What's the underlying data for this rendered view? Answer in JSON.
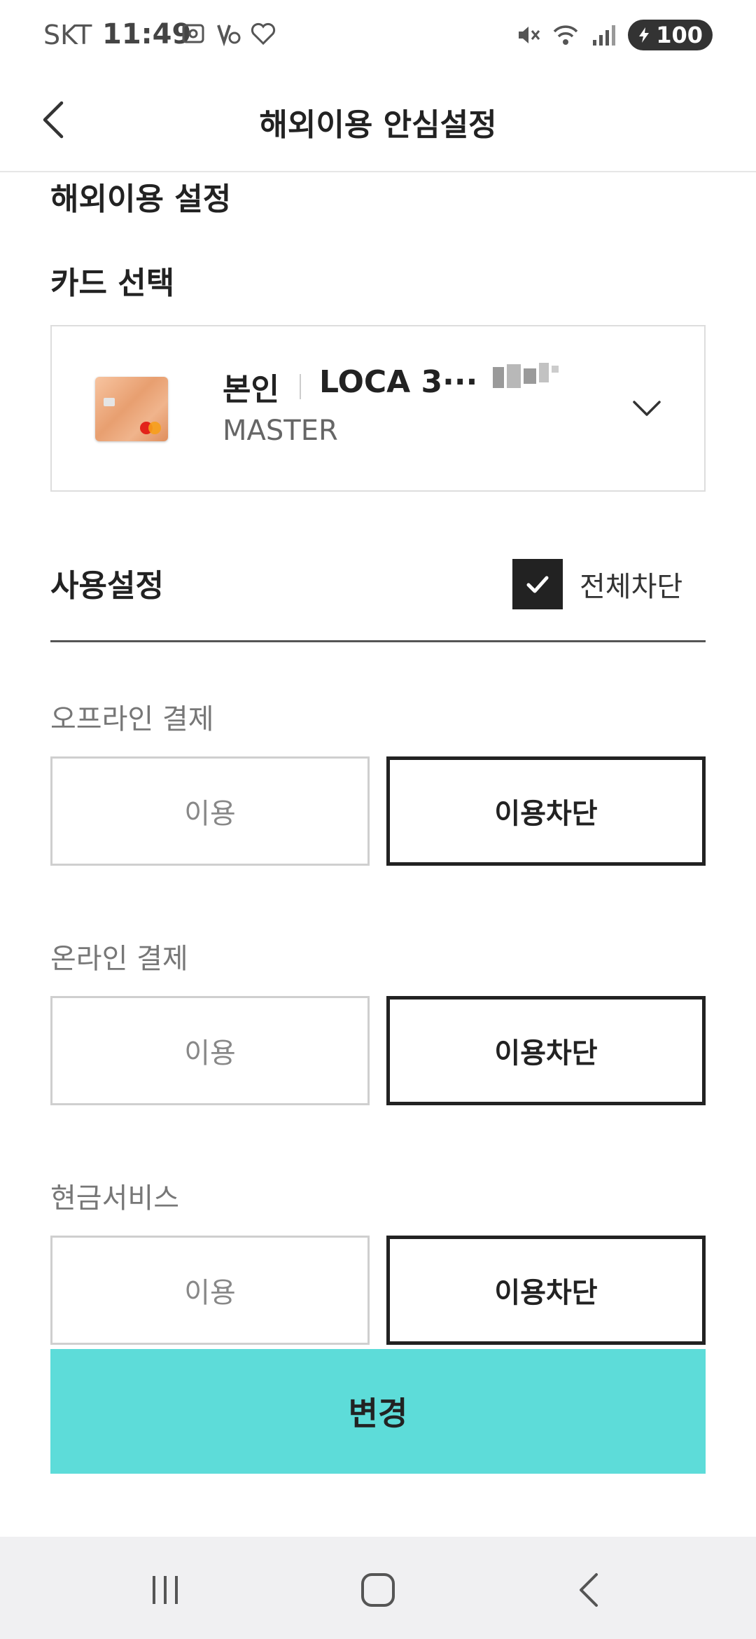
{
  "status_bar": {
    "carrier": "SKT",
    "time": "11:49",
    "battery": "100",
    "left_icons": [
      "screenshot-icon",
      "volte-icon",
      "one-ui-icon"
    ],
    "right_icons": [
      "mute-icon",
      "wifi-icon",
      "signal-icon",
      "battery-icon"
    ]
  },
  "header": {
    "title": "해외이용 안심설정",
    "back_icon": "chevron-left-icon"
  },
  "section": {
    "title": "해외이용 설정",
    "card_select_label": "카드 선택"
  },
  "card": {
    "owner": "본인",
    "name": "LOCA 3···",
    "brand": "MASTER",
    "dropdown_icon": "chevron-down-icon"
  },
  "usage": {
    "title": "사용설정",
    "block_all_label": "전체차단",
    "block_all_checked": true
  },
  "groups": [
    {
      "label": "오프라인 결제",
      "allow_label": "이용",
      "block_label": "이용차단",
      "selected": "block"
    },
    {
      "label": "온라인 결제",
      "allow_label": "이용",
      "block_label": "이용차단",
      "selected": "block"
    },
    {
      "label": "현금서비스",
      "allow_label": "이용",
      "block_label": "이용차단",
      "selected": "block"
    }
  ],
  "submit_label": "변경",
  "colors": {
    "accent": "#5ddcd9",
    "selected_border": "#222222",
    "unselected_border": "#cfcfcf"
  },
  "nav": {
    "items": [
      "recent-apps-icon",
      "home-icon",
      "back-icon"
    ]
  }
}
